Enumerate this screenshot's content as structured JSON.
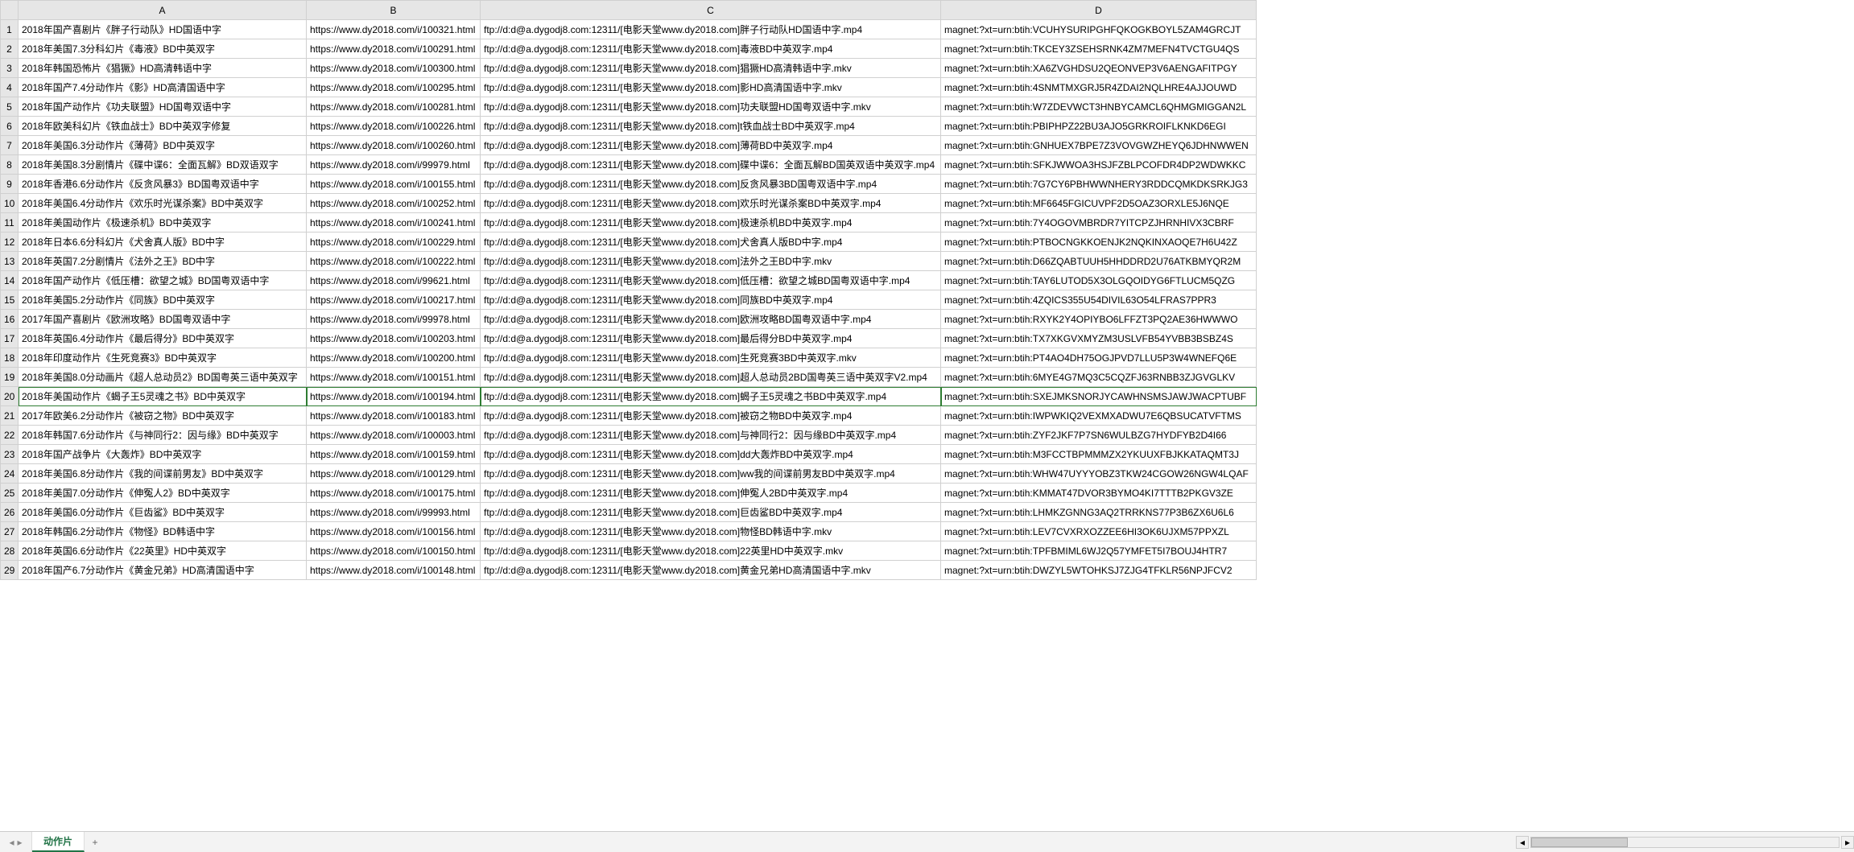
{
  "columns": [
    "A",
    "B",
    "C",
    "D"
  ],
  "selected_row_index": 19,
  "sheet_tab": {
    "active": "动作片",
    "add_label": "+"
  },
  "rows": [
    {
      "n": "1",
      "a": "2018年国产喜剧片《胖子行动队》HD国语中字",
      "b": "https://www.dy2018.com/i/100321.html",
      "c": "ftp://d:d@a.dygodj8.com:12311/[电影天堂www.dy2018.com]胖子行动队HD国语中字.mp4",
      "d": "magnet:?xt=urn:btih:VCUHYSURIPGHFQKOGKBOYL5ZAM4GRCJT"
    },
    {
      "n": "2",
      "a": "2018年美国7.3分科幻片《毒液》BD中英双字",
      "b": "https://www.dy2018.com/i/100291.html",
      "c": "ftp://d:d@a.dygodj8.com:12311/[电影天堂www.dy2018.com]毒液BD中英双字.mp4",
      "d": "magnet:?xt=urn:btih:TKCEY3ZSEHSRNK4ZM7MEFN4TVCTGU4QS"
    },
    {
      "n": "3",
      "a": "2018年韩国恐怖片《猖獗》HD高清韩语中字",
      "b": "https://www.dy2018.com/i/100300.html",
      "c": "ftp://d:d@a.dygodj8.com:12311/[电影天堂www.dy2018.com]猖獗HD高清韩语中字.mkv",
      "d": "magnet:?xt=urn:btih:XA6ZVGHDSU2QEONVEP3V6AENGAFITPGY"
    },
    {
      "n": "4",
      "a": "2018年国产7.4分动作片《影》HD高清国语中字",
      "b": "https://www.dy2018.com/i/100295.html",
      "c": "ftp://d:d@a.dygodj8.com:12311/[电影天堂www.dy2018.com]影HD高清国语中字.mkv",
      "d": "magnet:?xt=urn:btih:4SNMTMXGRJ5R4ZDAI2NQLHRE4AJJOUWD"
    },
    {
      "n": "5",
      "a": "2018年国产动作片《功夫联盟》HD国粤双语中字",
      "b": "https://www.dy2018.com/i/100281.html",
      "c": "ftp://d:d@a.dygodj8.com:12311/[电影天堂www.dy2018.com]功夫联盟HD国粤双语中字.mkv",
      "d": "magnet:?xt=urn:btih:W7ZDEVWCT3HNBYCAMCL6QHMGMIGGAN2L"
    },
    {
      "n": "6",
      "a": "2018年欧美科幻片《铁血战士》BD中英双字修复",
      "b": "https://www.dy2018.com/i/100226.html",
      "c": "ftp://d:d@a.dygodj8.com:12311/[电影天堂www.dy2018.com]t铁血战士BD中英双字.mp4",
      "d": "magnet:?xt=urn:btih:PBIPHPZ22BU3AJO5GRKROIFLKNKD6EGI"
    },
    {
      "n": "7",
      "a": "2018年美国6.3分动作片《薄荷》BD中英双字",
      "b": "https://www.dy2018.com/i/100260.html",
      "c": "ftp://d:d@a.dygodj8.com:12311/[电影天堂www.dy2018.com]薄荷BD中英双字.mp4",
      "d": "magnet:?xt=urn:btih:GNHUEX7BPE7Z3VOVGWZHEYQ6JDHNWWEN"
    },
    {
      "n": "8",
      "a": "2018年美国8.3分剧情片《碟中谍6：全面瓦解》BD双语双字",
      "b": "https://www.dy2018.com/i/99979.html",
      "c": "ftp://d:d@a.dygodj8.com:12311/[电影天堂www.dy2018.com]碟中谍6：全面瓦解BD国英双语中英双字.mp4",
      "d": "magnet:?xt=urn:btih:SFKJWWOA3HSJFZBLPCOFDR4DP2WDWKKC"
    },
    {
      "n": "9",
      "a": "2018年香港6.6分动作片《反贪风暴3》BD国粤双语中字",
      "b": "https://www.dy2018.com/i/100155.html",
      "c": "ftp://d:d@a.dygodj8.com:12311/[电影天堂www.dy2018.com]反贪风暴3BD国粤双语中字.mp4",
      "d": "magnet:?xt=urn:btih:7G7CY6PBHWWNHERY3RDDCQMKDKSRKJG3"
    },
    {
      "n": "10",
      "a": "2018年美国6.4分动作片《欢乐时光谋杀案》BD中英双字",
      "b": "https://www.dy2018.com/i/100252.html",
      "c": "ftp://d:d@a.dygodj8.com:12311/[电影天堂www.dy2018.com]欢乐时光谋杀案BD中英双字.mp4",
      "d": "magnet:?xt=urn:btih:MF6645FGICUVPF2D5OAZ3ORXLE5J6NQE"
    },
    {
      "n": "11",
      "a": "2018年美国动作片《极速杀机》BD中英双字",
      "b": "https://www.dy2018.com/i/100241.html",
      "c": "ftp://d:d@a.dygodj8.com:12311/[电影天堂www.dy2018.com]极速杀机BD中英双字.mp4",
      "d": "magnet:?xt=urn:btih:7Y4OGOVMBRDR7YITCPZJHRNHIVX3CBRF"
    },
    {
      "n": "12",
      "a": "2018年日本6.6分科幻片《犬舍真人版》BD中字",
      "b": "https://www.dy2018.com/i/100229.html",
      "c": "ftp://d:d@a.dygodj8.com:12311/[电影天堂www.dy2018.com]犬舍真人版BD中字.mp4",
      "d": "magnet:?xt=urn:btih:PTBOCNGKKOENJK2NQKINXAOQE7H6U42Z"
    },
    {
      "n": "13",
      "a": "2018年英国7.2分剧情片《法外之王》BD中字",
      "b": "https://www.dy2018.com/i/100222.html",
      "c": "ftp://d:d@a.dygodj8.com:12311/[电影天堂www.dy2018.com]法外之王BD中字.mkv",
      "d": "magnet:?xt=urn:btih:D66ZQABTUUH5HHDDRD2U76ATKBMYQR2M"
    },
    {
      "n": "14",
      "a": "2018年国产动作片《低压槽：欲望之城》BD国粤双语中字",
      "b": "https://www.dy2018.com/i/99621.html",
      "c": "ftp://d:d@a.dygodj8.com:12311/[电影天堂www.dy2018.com]低压槽：欲望之城BD国粤双语中字.mp4",
      "d": "magnet:?xt=urn:btih:TAY6LUTOD5X3OLGQOIDYG6FTLUCM5QZG"
    },
    {
      "n": "15",
      "a": "2018年美国5.2分动作片《同族》BD中英双字",
      "b": "https://www.dy2018.com/i/100217.html",
      "c": "ftp://d:d@a.dygodj8.com:12311/[电影天堂www.dy2018.com]同族BD中英双字.mp4",
      "d": "magnet:?xt=urn:btih:4ZQICS355U54DIVIL63O54LFRAS7PPR3"
    },
    {
      "n": "16",
      "a": "2017年国产喜剧片《欧洲攻略》BD国粤双语中字",
      "b": "https://www.dy2018.com/i/99978.html",
      "c": "ftp://d:d@a.dygodj8.com:12311/[电影天堂www.dy2018.com]欧洲攻略BD国粤双语中字.mp4",
      "d": "magnet:?xt=urn:btih:RXYK2Y4OPIYBO6LFFZT3PQ2AE36HWWWO"
    },
    {
      "n": "17",
      "a": "2018年英国6.4分动作片《最后得分》BD中英双字",
      "b": "https://www.dy2018.com/i/100203.html",
      "c": "ftp://d:d@a.dygodj8.com:12311/[电影天堂www.dy2018.com]最后得分BD中英双字.mp4",
      "d": "magnet:?xt=urn:btih:TX7XKGVXMYZM3USLVFB54YVBB3BSBZ4S"
    },
    {
      "n": "18",
      "a": "2018年印度动作片《生死竞赛3》BD中英双字",
      "b": "https://www.dy2018.com/i/100200.html",
      "c": "ftp://d:d@a.dygodj8.com:12311/[电影天堂www.dy2018.com]生死竞赛3BD中英双字.mkv",
      "d": "magnet:?xt=urn:btih:PT4AO4DH75OGJPVD7LLU5P3W4WNEFQ6E"
    },
    {
      "n": "19",
      "a": "2018年美国8.0分动画片《超人总动员2》BD国粤英三语中英双字",
      "b": "https://www.dy2018.com/i/100151.html",
      "c": "ftp://d:d@a.dygodj8.com:12311/[电影天堂www.dy2018.com]超人总动员2BD国粤英三语中英双字V2.mp4",
      "d": "magnet:?xt=urn:btih:6MYE4G7MQ3C5CQZFJ63RNBB3ZJGVGLKV"
    },
    {
      "n": "20",
      "a": "2018年美国动作片《蝎子王5灵魂之书》BD中英双字",
      "b": "https://www.dy2018.com/i/100194.html",
      "c": "ftp://d:d@a.dygodj8.com:12311/[电影天堂www.dy2018.com]蝎子王5灵魂之书BD中英双字.mp4",
      "d": "magnet:?xt=urn:btih:SXEJMKSNORJYCAWHNSMSJAWJWACPTUBF"
    },
    {
      "n": "21",
      "a": "2017年欧美6.2分动作片《被窃之物》BD中英双字",
      "b": "https://www.dy2018.com/i/100183.html",
      "c": "ftp://d:d@a.dygodj8.com:12311/[电影天堂www.dy2018.com]被窃之物BD中英双字.mp4",
      "d": "magnet:?xt=urn:btih:IWPWKIQ2VEXMXADWU7E6QBSUCATVFTMS"
    },
    {
      "n": "22",
      "a": "2018年韩国7.6分动作片《与神同行2：因与缘》BD中英双字",
      "b": "https://www.dy2018.com/i/100003.html",
      "c": "ftp://d:d@a.dygodj8.com:12311/[电影天堂www.dy2018.com]与神同行2：因与缘BD中英双字.mp4",
      "d": "magnet:?xt=urn:btih:ZYF2JKF7P7SN6WULBZG7HYDFYB2D4I66"
    },
    {
      "n": "23",
      "a": "2018年国产战争片《大轰炸》BD中英双字",
      "b": "https://www.dy2018.com/i/100159.html",
      "c": "ftp://d:d@a.dygodj8.com:12311/[电影天堂www.dy2018.com]dd大轰炸BD中英双字.mp4",
      "d": "magnet:?xt=urn:btih:M3FCCTBPMMMZX2YKUUXFBJKKATAQMT3J"
    },
    {
      "n": "24",
      "a": "2018年美国6.8分动作片《我的间谍前男友》BD中英双字",
      "b": "https://www.dy2018.com/i/100129.html",
      "c": "ftp://d:d@a.dygodj8.com:12311/[电影天堂www.dy2018.com]ww我的间谍前男友BD中英双字.mp4",
      "d": "magnet:?xt=urn:btih:WHW47UYYYOBZ3TKW24CGOW26NGW4LQAF"
    },
    {
      "n": "25",
      "a": "2018年美国7.0分动作片《伸冤人2》BD中英双字",
      "b": "https://www.dy2018.com/i/100175.html",
      "c": "ftp://d:d@a.dygodj8.com:12311/[电影天堂www.dy2018.com]伸冤人2BD中英双字.mp4",
      "d": "magnet:?xt=urn:btih:KMMAT47DVOR3BYMO4KI7TTTB2PKGV3ZE"
    },
    {
      "n": "26",
      "a": "2018年美国6.0分动作片《巨齿鲨》BD中英双字",
      "b": "https://www.dy2018.com/i/99993.html",
      "c": "ftp://d:d@a.dygodj8.com:12311/[电影天堂www.dy2018.com]巨齿鲨BD中英双字.mp4",
      "d": "magnet:?xt=urn:btih:LHMKZGNNG3AQ2TRRKNS77P3B6ZX6U6L6"
    },
    {
      "n": "27",
      "a": "2018年韩国6.2分动作片《物怪》BD韩语中字",
      "b": "https://www.dy2018.com/i/100156.html",
      "c": "ftp://d:d@a.dygodj8.com:12311/[电影天堂www.dy2018.com]物怪BD韩语中字.mkv",
      "d": "magnet:?xt=urn:btih:LEV7CVXRXOZZEE6HI3OK6UJXM57PPXZL"
    },
    {
      "n": "28",
      "a": "2018年英国6.6分动作片《22英里》HD中英双字",
      "b": "https://www.dy2018.com/i/100150.html",
      "c": "ftp://d:d@a.dygodj8.com:12311/[电影天堂www.dy2018.com]22英里HD中英双字.mkv",
      "d": "magnet:?xt=urn:btih:TPFBMIML6WJ2Q57YMFET5I7BOUJ4HTR7"
    },
    {
      "n": "29",
      "a": "2018年国产6.7分动作片《黄金兄弟》HD高清国语中字",
      "b": "https://www.dy2018.com/i/100148.html",
      "c": "ftp://d:d@a.dygodj8.com:12311/[电影天堂www.dy2018.com]黄金兄弟HD高清国语中字.mkv",
      "d": "magnet:?xt=urn:btih:DWZYL5WTOHKSJ7ZJG4TFKLR56NPJFCV2"
    }
  ]
}
